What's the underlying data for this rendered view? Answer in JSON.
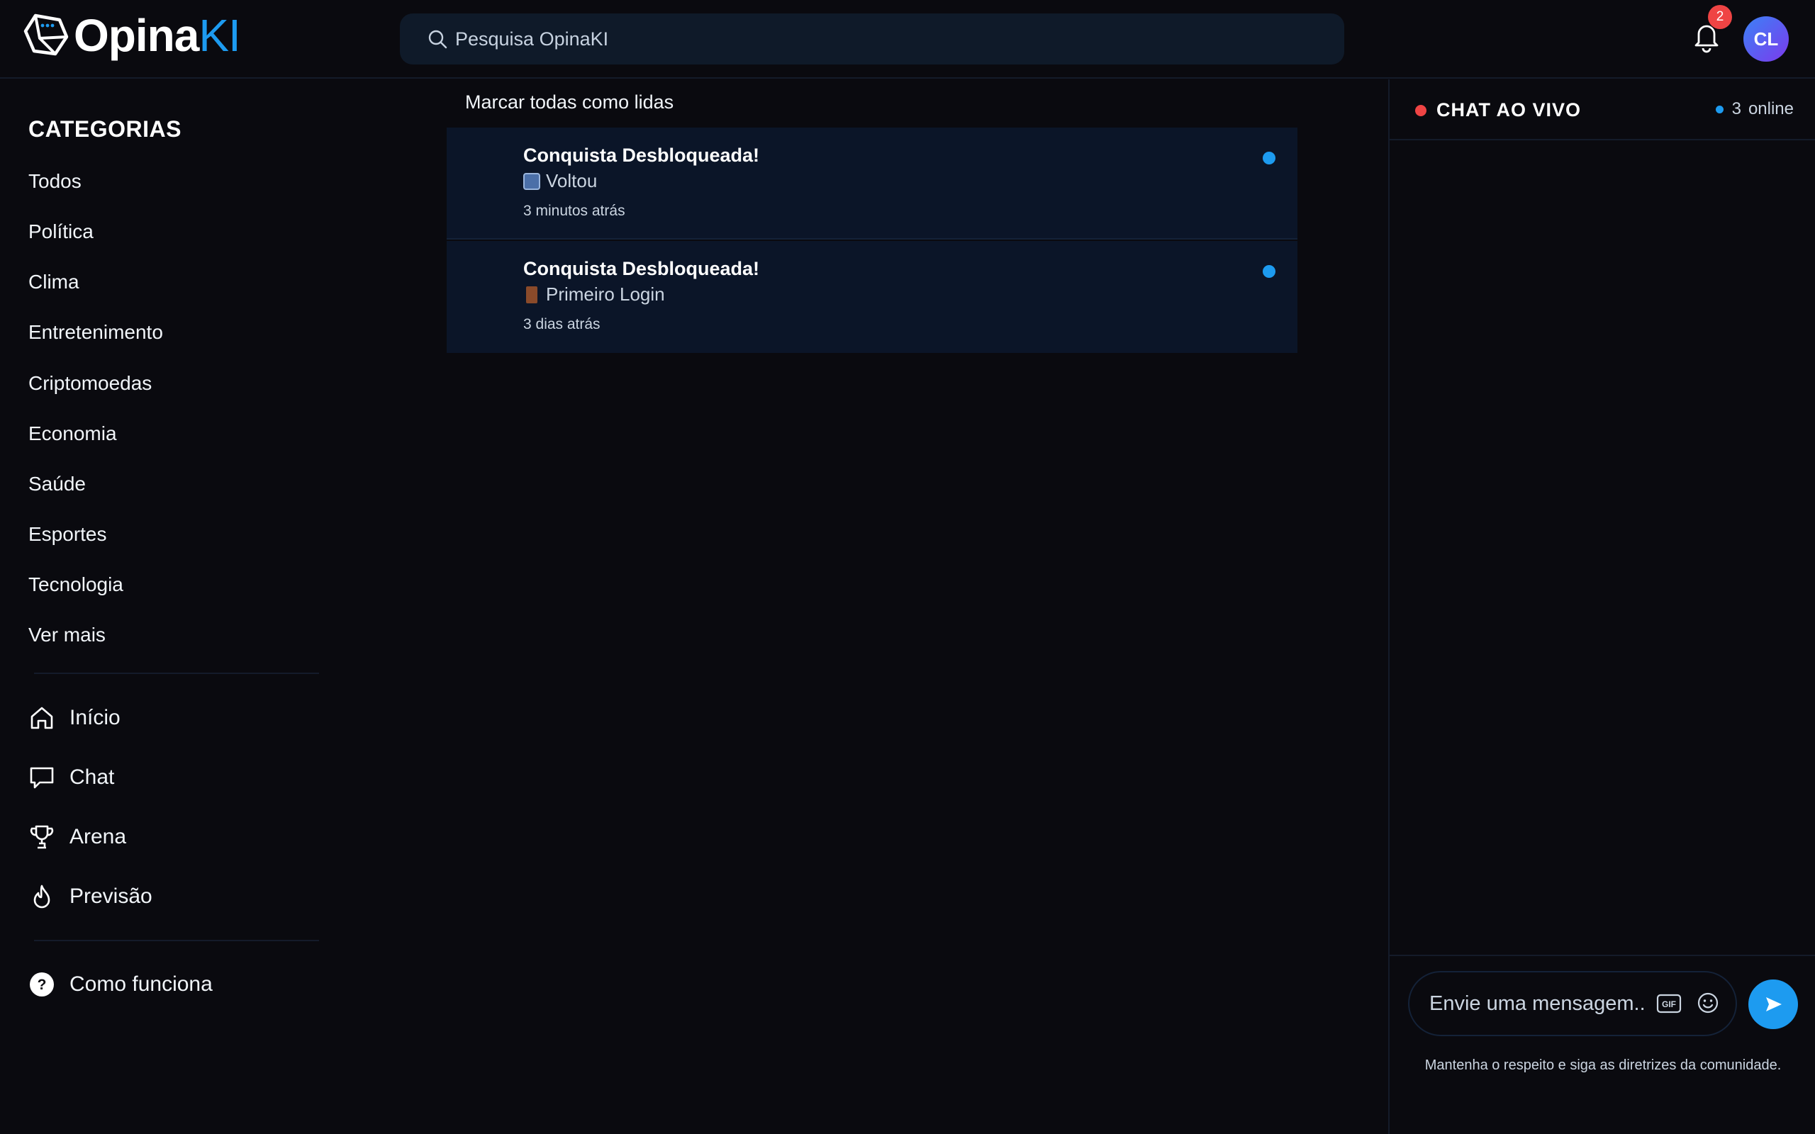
{
  "brand": {
    "name_part1": "Opina",
    "name_part2": "KI",
    "accent": "#1d9bf0"
  },
  "search": {
    "placeholder": "Pesquisa OpinaKI"
  },
  "notifications_badge": {
    "count": "2"
  },
  "user": {
    "initials": "CL"
  },
  "sidebar": {
    "categories_title": "CATEGORIAS",
    "categories": [
      "Todos",
      "Política",
      "Clima",
      "Entretenimento",
      "Criptomoedas",
      "Economia",
      "Saúde",
      "Esportes",
      "Tecnologia",
      "Ver mais"
    ],
    "nav": [
      {
        "label": "Início",
        "icon": "home-icon"
      },
      {
        "label": "Chat",
        "icon": "chat-bubble-icon"
      },
      {
        "label": "Arena",
        "icon": "trophy-icon"
      },
      {
        "label": "Previsão",
        "icon": "flame-icon"
      }
    ],
    "help": {
      "label": "Como funciona",
      "icon": "question-circle-icon"
    }
  },
  "main": {
    "mark_all_read": "Marcar todas como lidas",
    "notifications": [
      {
        "title": "Conquista Desbloqueada!",
        "body": "Voltou",
        "emoji_icon": "return-emoji-icon",
        "time": "3 minutos atrás",
        "unread": true
      },
      {
        "title": "Conquista Desbloqueada!",
        "body": "Primeiro Login",
        "emoji_icon": "door-emoji-icon",
        "time": "3 dias atrás",
        "unread": true
      }
    ]
  },
  "chat": {
    "title": "CHAT AO VIVO",
    "online_count": "3",
    "online_label": "online",
    "input_placeholder": "Envie uma mensagem...",
    "guideline_note": "Mantenha o respeito e siga as diretrizes da comunidade.",
    "live_color": "#ef4444"
  }
}
